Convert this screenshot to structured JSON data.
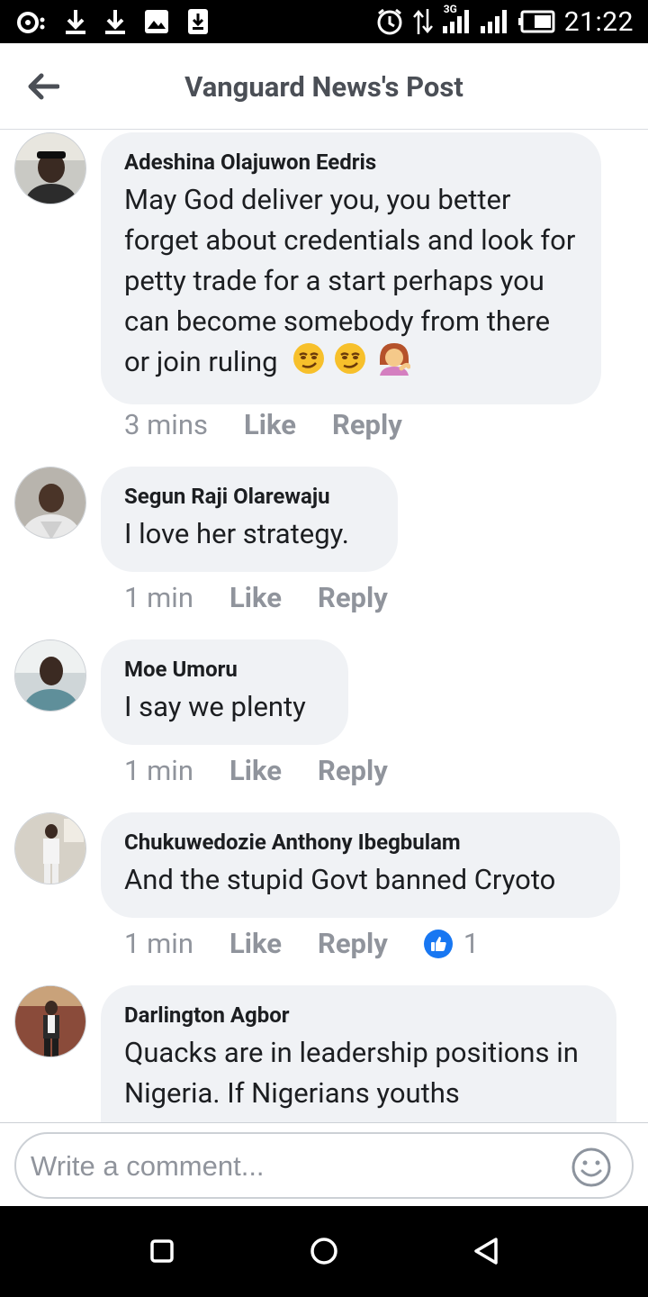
{
  "status_bar": {
    "time": "21:22",
    "network_type": "3G",
    "icons": [
      "radio-icon",
      "download-icon",
      "download-icon",
      "image-icon",
      "download-box-icon",
      "alarm-icon",
      "data-arrows-icon",
      "signal-icon",
      "signal-icon",
      "battery-icon"
    ]
  },
  "header": {
    "title": "Vanguard News's Post",
    "back_icon": "arrow-left-icon"
  },
  "comments": [
    {
      "author": "Adeshina Olajuwon Eedris",
      "text": "May God deliver you, you better forget about credentials and look for petty trade for a start perhaps you can become somebody from there or join ruling",
      "emojis": [
        "smirk-emoji",
        "smirk-emoji",
        "tipping-hand-woman-emoji"
      ],
      "time": "3 mins",
      "like_label": "Like",
      "reply_label": "Reply"
    },
    {
      "author": "Segun Raji Olarewaju",
      "text": "I love her strategy.",
      "time": "1 min",
      "like_label": "Like",
      "reply_label": "Reply"
    },
    {
      "author": "Moe Umoru",
      "text": "I say we plenty",
      "time": "1 min",
      "like_label": "Like",
      "reply_label": "Reply"
    },
    {
      "author": "Chukuwedozie Anthony Ibegbulam",
      "text": "And the stupid Govt banned Cryoto",
      "time": "1 min",
      "like_label": "Like",
      "reply_label": "Reply",
      "reaction_count": "1"
    },
    {
      "author": "Darlington Agbor",
      "text": "Quacks are in leadership positions in Nigeria. If Nigerians youths"
    }
  ],
  "composer": {
    "placeholder": "Write a comment...",
    "emoji_icon": "smiley-face-icon"
  },
  "colors": {
    "bubble": "#f0f2f5",
    "muted_text": "#90949c",
    "like_blue": "#1877f2",
    "header_text": "#4b4f56"
  }
}
